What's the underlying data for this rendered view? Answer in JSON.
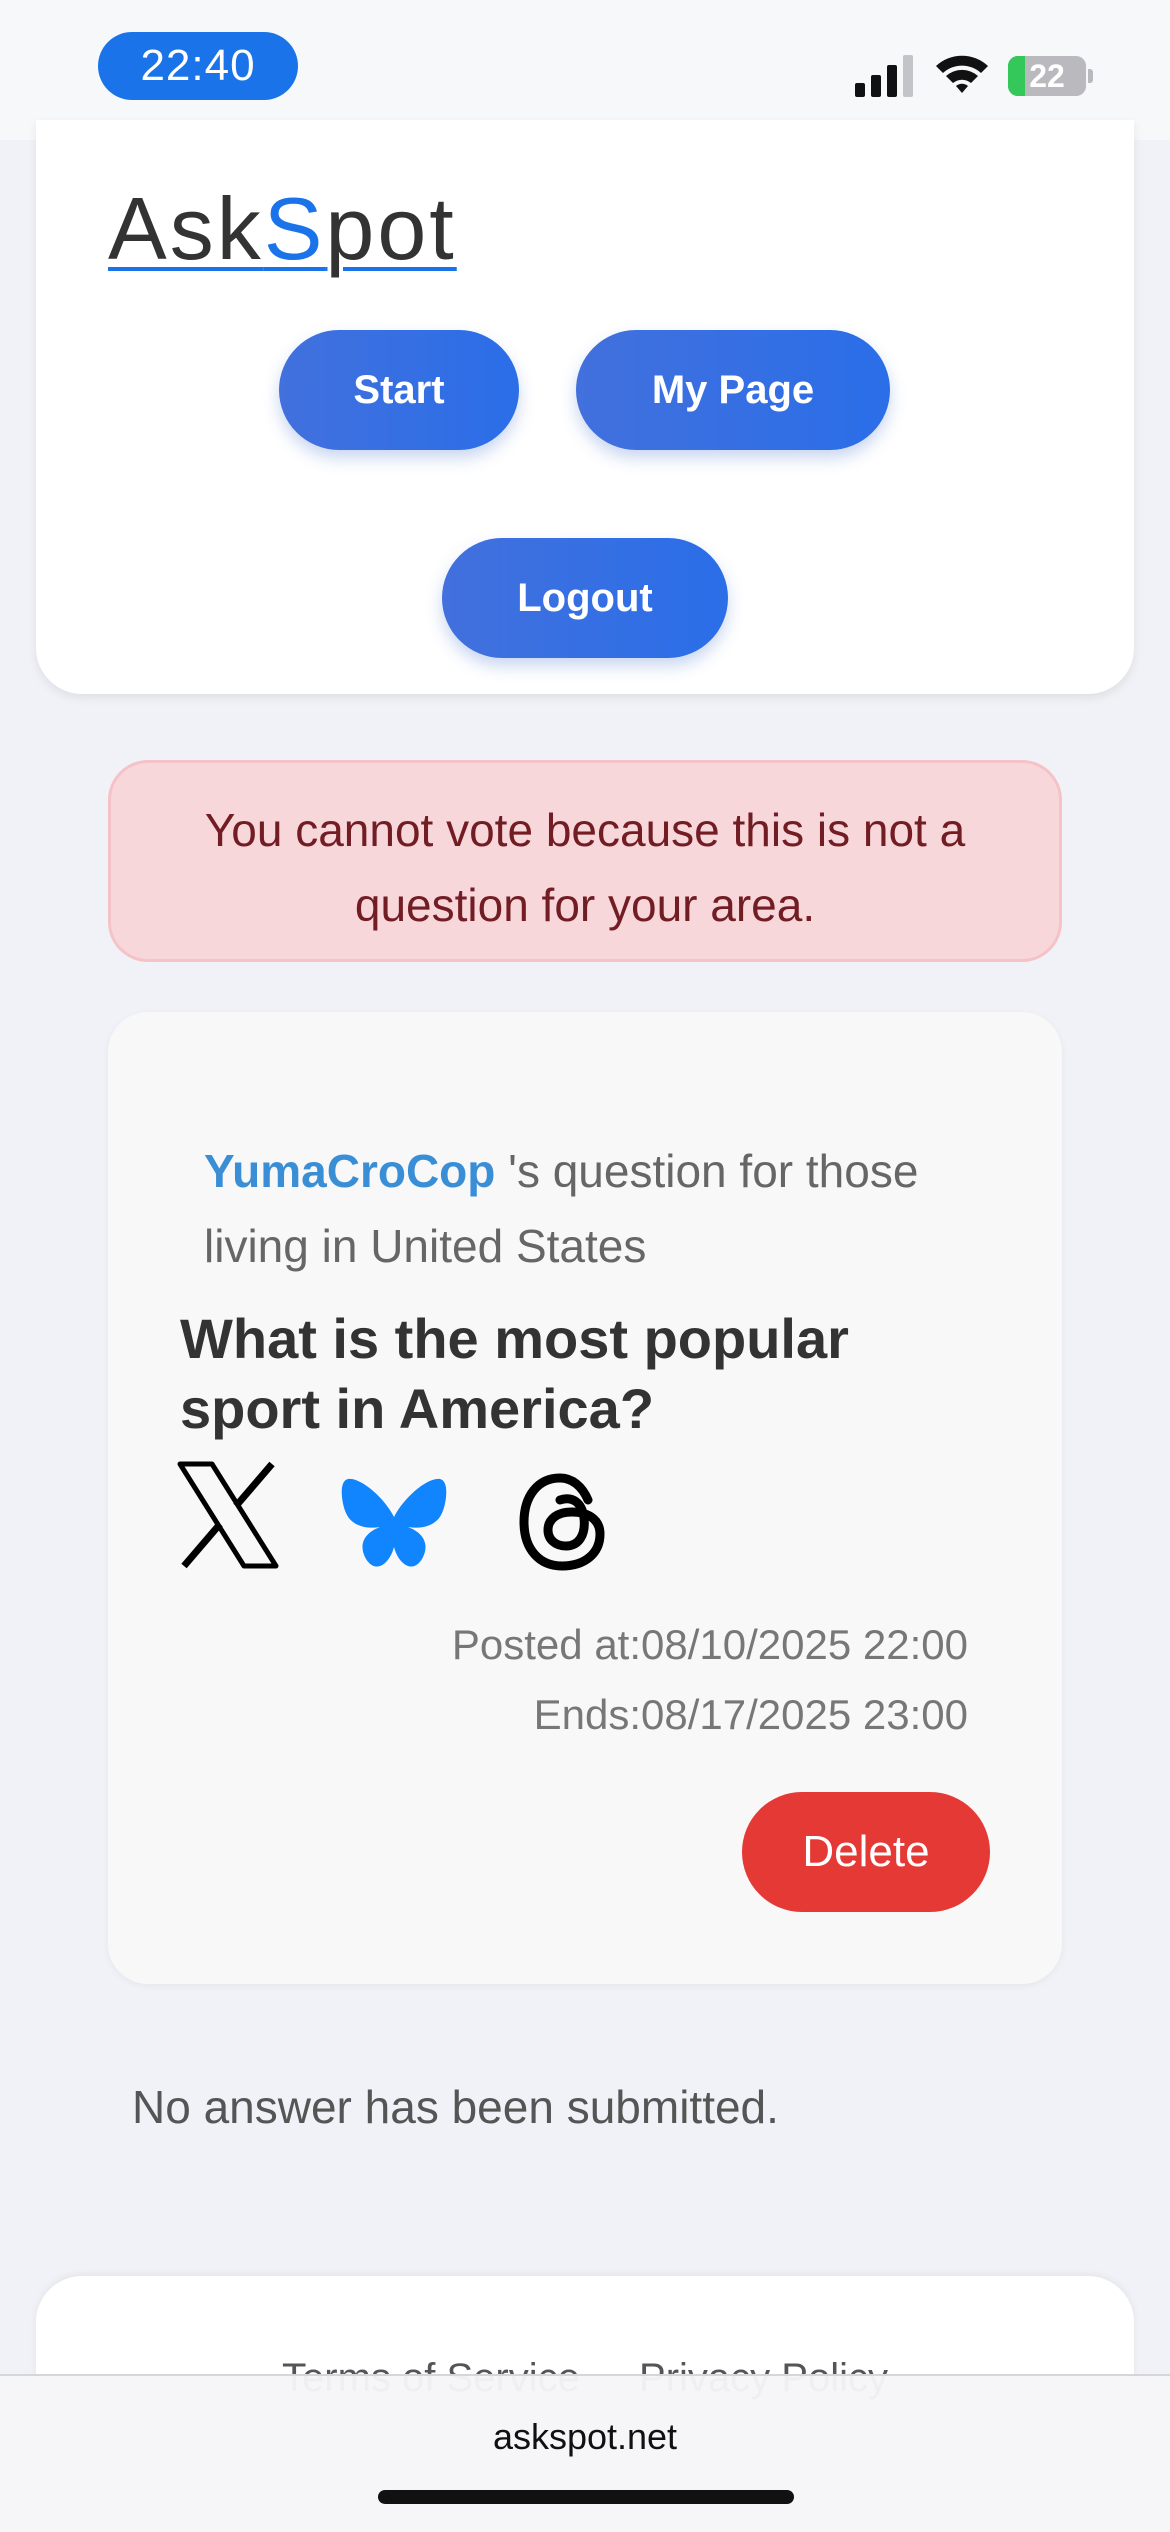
{
  "status_bar": {
    "time": "22:40",
    "battery_level": "22",
    "battery_fraction": 0.22,
    "icons": [
      "signal-icon",
      "wifi-icon",
      "battery-charging-icon"
    ]
  },
  "header": {
    "logo_prefix": "Ask",
    "logo_accent": "S",
    "logo_suffix": "pot",
    "buttons": {
      "start": "Start",
      "my_page": "My Page",
      "logout": "Logout"
    }
  },
  "alert": {
    "message": "You cannot vote because this is not a question for your area."
  },
  "question": {
    "author": "YumaCroCop",
    "author_suffix": " 's question for those living in United States",
    "title": "What is the most popular sport in America?",
    "share_icons": [
      "x-icon",
      "bluesky-icon",
      "threads-icon"
    ],
    "posted_at": "Posted at:08/10/2025 22:00",
    "ends": "Ends:08/17/2025 23:00",
    "delete_label": "Delete"
  },
  "answers": {
    "empty_message": "No answer has been submitted."
  },
  "footer": {
    "terms": "Terms of Service",
    "privacy": "Privacy Policy"
  },
  "browser": {
    "url": "askspot.net"
  },
  "colors": {
    "accent": "#1a73e8",
    "button_gradient_start": "#4270dd",
    "button_gradient_end": "#2a6ee8",
    "alert_bg": "#f8d7da",
    "alert_text": "#721c24",
    "delete": "#e53935",
    "author_link": "#3a8ed6"
  }
}
